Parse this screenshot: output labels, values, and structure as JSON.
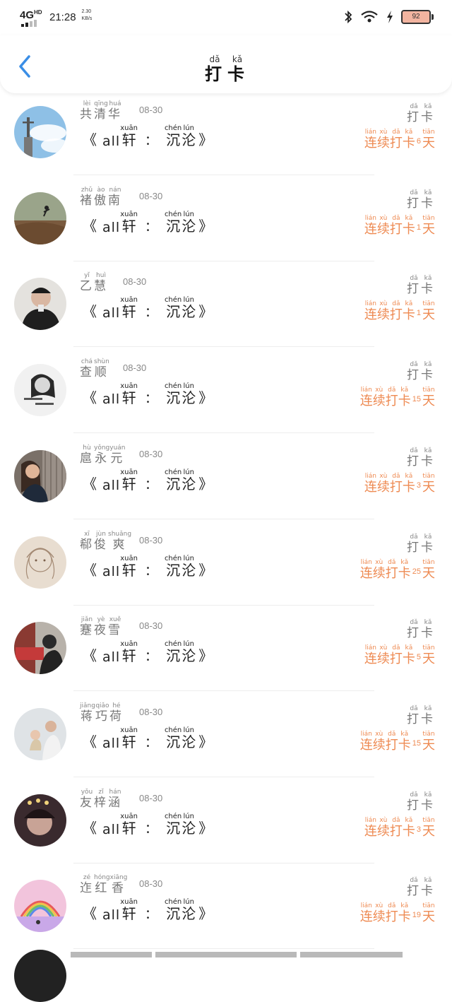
{
  "status_bar": {
    "network": "4G",
    "network_sup": "HD",
    "time": "21:28",
    "speed_value": "2.30",
    "speed_unit": "KB/s",
    "battery": "92",
    "icons": [
      "bluetooth-icon",
      "wifi-icon",
      "charging-icon"
    ]
  },
  "nav": {
    "back_icon": "chevron-left-icon",
    "title": [
      {
        "char": "打",
        "pinyin": "dǎ"
      },
      {
        "char": "卡",
        "pinyin": "kǎ"
      }
    ]
  },
  "common": {
    "punch_chars": [
      {
        "char": "打",
        "pinyin": "dǎ"
      },
      {
        "char": "卡",
        "pinyin": "kǎ"
      }
    ],
    "streak_prefix": [
      {
        "char": "连",
        "pinyin": "lián"
      },
      {
        "char": "续",
        "pinyin": "xù"
      },
      {
        "char": "打",
        "pinyin": "dǎ"
      },
      {
        "char": "卡",
        "pinyin": "kǎ"
      }
    ],
    "streak_suffix": {
      "char": "天",
      "pinyin": "tiān"
    },
    "book": {
      "open_quote": "《",
      "latin": "all",
      "word1": {
        "char": "轩",
        "pinyin": "xuān"
      },
      "colon": "：",
      "word2": [
        {
          "char": "沉",
          "pinyin": "chén"
        },
        {
          "char": "沦",
          "pinyin": "lún"
        }
      ],
      "close_quote": "》"
    },
    "colors": {
      "streak": "#ee8a52",
      "name": "#777777",
      "divider": "#ededed"
    }
  },
  "entries": [
    {
      "name": [
        {
          "char": "共",
          "pinyin": "lèi"
        },
        {
          "char": "清",
          "pinyin": "qīng"
        },
        {
          "char": "华",
          "pinyin": "huá"
        }
      ],
      "date": "08-30",
      "days": "6"
    },
    {
      "name": [
        {
          "char": "褚",
          "pinyin": "zhǔ"
        },
        {
          "char": "傲",
          "pinyin": "ào"
        },
        {
          "char": "南",
          "pinyin": "nán"
        }
      ],
      "date": "08-30",
      "days": "1"
    },
    {
      "name": [
        {
          "char": "乙",
          "pinyin": "yǐ"
        },
        {
          "char": "慧",
          "pinyin": "huì"
        }
      ],
      "date": "08-30",
      "days": "1"
    },
    {
      "name": [
        {
          "char": "查",
          "pinyin": "chá"
        },
        {
          "char": "顺",
          "pinyin": "shùn"
        }
      ],
      "date": "08-30",
      "days": "15"
    },
    {
      "name": [
        {
          "char": "扈",
          "pinyin": "hù"
        },
        {
          "char": "永",
          "pinyin": "yǒng"
        },
        {
          "char": "元",
          "pinyin": "yuán"
        }
      ],
      "date": "08-30",
      "days": "3"
    },
    {
      "name": [
        {
          "char": "郗",
          "pinyin": "xī"
        },
        {
          "char": "俊",
          "pinyin": "jùn"
        },
        {
          "char": "爽",
          "pinyin": "shuǎng"
        }
      ],
      "date": "08-30",
      "days": "25"
    },
    {
      "name": [
        {
          "char": "蹇",
          "pinyin": "jiǎn"
        },
        {
          "char": "夜",
          "pinyin": "yè"
        },
        {
          "char": "雪",
          "pinyin": "xuě"
        }
      ],
      "date": "08-30",
      "days": "5"
    },
    {
      "name": [
        {
          "char": "蒋",
          "pinyin": "jiǎng"
        },
        {
          "char": "巧",
          "pinyin": "qiǎo"
        },
        {
          "char": "荷",
          "pinyin": "hé"
        }
      ],
      "date": "08-30",
      "days": "15"
    },
    {
      "name": [
        {
          "char": "友",
          "pinyin": "yǒu"
        },
        {
          "char": "梓",
          "pinyin": "zǐ"
        },
        {
          "char": "涵",
          "pinyin": "hán"
        }
      ],
      "date": "08-30",
      "days": "3"
    },
    {
      "name": [
        {
          "char": "迮",
          "pinyin": "zé"
        },
        {
          "char": "红",
          "pinyin": "hóng"
        },
        {
          "char": "香",
          "pinyin": "xiāng"
        }
      ],
      "date": "08-30",
      "days": "19"
    }
  ]
}
